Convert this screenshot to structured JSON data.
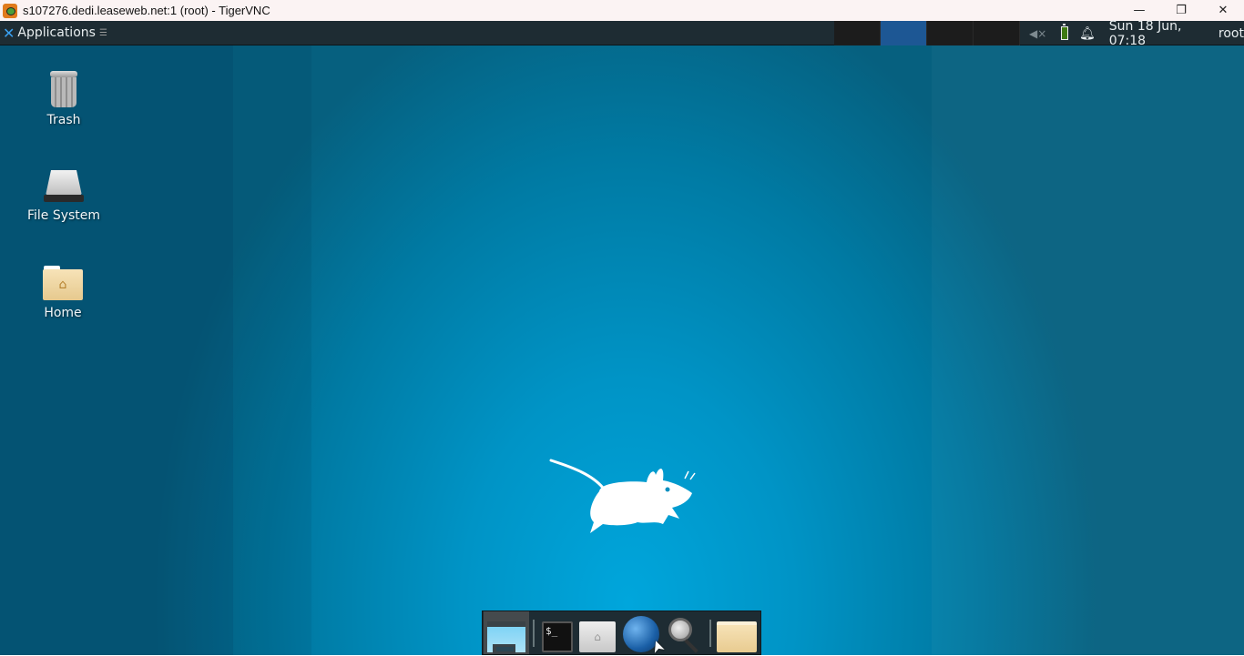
{
  "window": {
    "title": "s107276.dedi.leaseweb.net:1 (root) - TigerVNC",
    "controls": {
      "minimize": "—",
      "restore": "❐",
      "close": "✕"
    }
  },
  "panel": {
    "applications_label": "Applications",
    "workspaces": [
      {
        "id": 1,
        "active": false
      },
      {
        "id": 2,
        "active": true
      },
      {
        "id": 3,
        "active": false
      },
      {
        "id": 4,
        "active": false
      }
    ],
    "tray": {
      "volume_icon": "speaker-muted-icon",
      "battery_icon": "battery-icon",
      "notification_icon": "bell-icon",
      "clock": "Sun 18 Jun, 07:18",
      "user": "root"
    }
  },
  "desktop": {
    "icons": [
      {
        "label": "Trash",
        "icon": "trash-icon"
      },
      {
        "label": "File System",
        "icon": "hard-drive-icon"
      },
      {
        "label": "Home",
        "icon": "home-folder-icon"
      }
    ]
  },
  "dock": {
    "items": [
      {
        "name": "show-desktop",
        "icon": "show-desktop-icon",
        "active": true
      },
      {
        "name": "terminal",
        "icon": "terminal-icon",
        "glyph": "$_"
      },
      {
        "name": "file-manager",
        "icon": "home-folder-icon",
        "glyph": "⌂"
      },
      {
        "name": "web-browser",
        "icon": "globe-icon"
      },
      {
        "name": "app-finder",
        "icon": "magnifier-icon"
      },
      {
        "name": "folder",
        "icon": "folder-icon"
      }
    ]
  },
  "colors": {
    "panel_bg": "#1e2c33",
    "active_workspace": "#1d5794",
    "desktop_center": "#00a6dc",
    "titlebar_bg": "#fbf3f3"
  }
}
